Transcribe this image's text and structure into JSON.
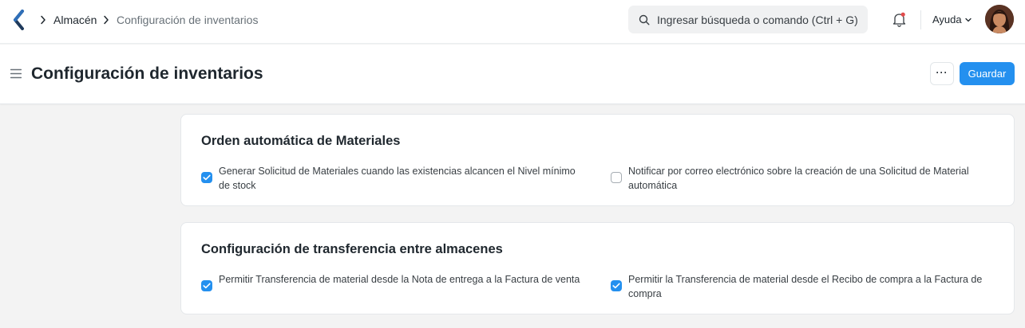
{
  "navbar": {
    "breadcrumbs": [
      "Almacén",
      "Configuración de inventarios"
    ],
    "search_placeholder": "Ingresar búsqueda o comando (Ctrl + G)",
    "help_label": "Ayuda",
    "icons": {
      "logo": "app-logo-icon",
      "search": "search-icon",
      "notifications": "bell-icon",
      "help_dropdown": "chevron-down-icon"
    },
    "accent_color": "#2490ef"
  },
  "page": {
    "title": "Configuración de inventarios",
    "more_label": "···",
    "save_label": "Guardar"
  },
  "sections": [
    {
      "title": "Orden automática de Materiales",
      "fields": [
        {
          "label": "Generar Solicitud de Materiales cuando las existencias alcancen el Nivel mínimo de stock",
          "checked": true
        },
        {
          "label": "Notificar por correo electrónico sobre la creación de una Solicitud de Material automática",
          "checked": false
        }
      ]
    },
    {
      "title": "Configuración de transferencia entre almacenes",
      "fields": [
        {
          "label": "Permitir Transferencia de material desde la Nota de entrega a la Factura de venta",
          "checked": true
        },
        {
          "label": "Permitir la Transferencia de material desde el Recibo de compra a la Factura de compra",
          "checked": true
        }
      ]
    }
  ]
}
